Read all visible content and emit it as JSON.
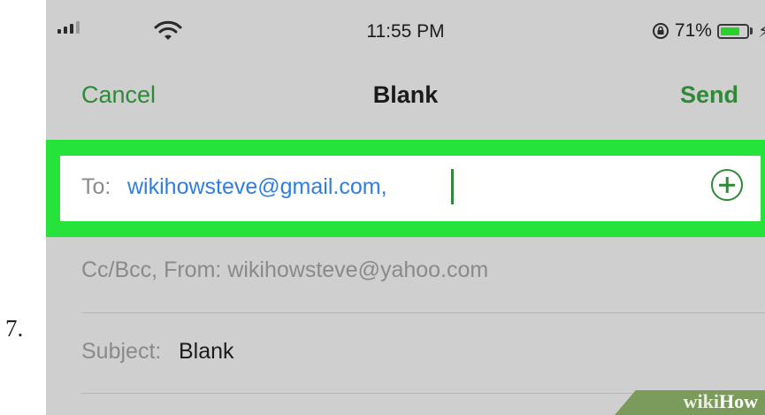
{
  "step_number": "7.",
  "status_bar": {
    "time": "11:55 PM",
    "battery_percent": "71%",
    "battery_level": 0.71,
    "icons": [
      "signal-icon",
      "wifi-icon",
      "rotation-lock-icon",
      "battery-icon",
      "charging-bolt-icon"
    ]
  },
  "nav": {
    "cancel_label": "Cancel",
    "title": "Blank",
    "send_label": "Send"
  },
  "compose": {
    "to_label": "To:",
    "to_value": "wikihowsteve@gmail.com,",
    "cc_label": "Cc/Bcc, From:",
    "cc_value": "wikihowsteve@yahoo.com",
    "subject_label": "Subject:",
    "subject_value": "Blank"
  },
  "colors": {
    "accent": "#2e8a37",
    "link": "#2f7ee2",
    "highlight": "#26e33c",
    "background": "#cfcfcf"
  },
  "watermark": {
    "part1": "wiki",
    "part2": "How"
  }
}
